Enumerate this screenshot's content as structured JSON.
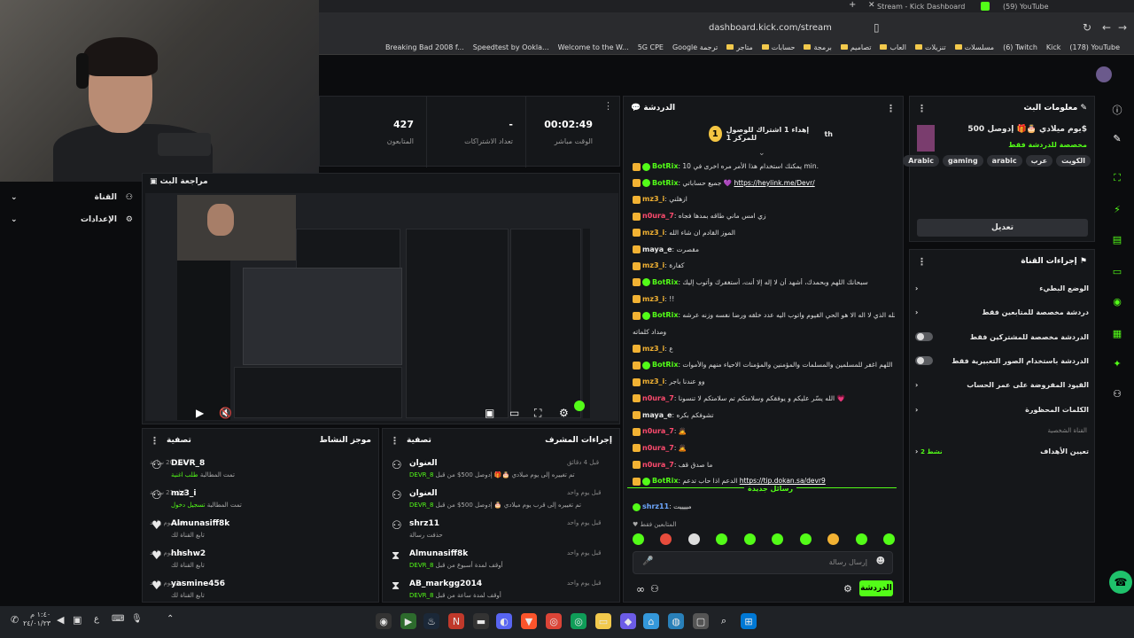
{
  "browser": {
    "tabs": [
      {
        "label": "Stream - Kick Dashboard"
      },
      {
        "label": "(59) YouTube"
      }
    ],
    "url": "dashboard.kick.com/stream",
    "bookmarks": [
      "(178) YouTube",
      "Kick",
      "(6) Twitch",
      "مسلسلات",
      "تنزيلات",
      "العاب",
      "تصاميم",
      "برمجة",
      "حسابات",
      "متاجر",
      "Google ترجمة",
      "5G CPE",
      "Welcome to the W...",
      "Speedtest by Ookla...",
      "Breaking Bad 2008 f..."
    ]
  },
  "sidebar": {
    "channel": "القناة",
    "settings": "الإعدادات"
  },
  "stats": {
    "live_time_value": "00:02:49",
    "live_time_label": "الوقت مباشر",
    "subs_value": "-",
    "subs_label": "تعداد الاشتراكات",
    "viewers_value": "427",
    "viewers_label": "المتابعون"
  },
  "preview": {
    "title": "مراجعة البث"
  },
  "activity": {
    "title": "موجز النشاط",
    "filter": "تصفية",
    "items": [
      {
        "name": "DEVR_8",
        "sub": "تمت المطالبة",
        "sub2": "طلب اغنية",
        "time": "قبل 20 ساعة"
      },
      {
        "name": "mz3_i",
        "sub": "تمت المطالبة",
        "sub2": "تسجيل دخول",
        "time": "قبل 21 ساعة"
      },
      {
        "name": "Almunasiff8k",
        "sub": "تابع القناة لك",
        "sub2": "",
        "time": "قبل يوم واحد"
      },
      {
        "name": "hhshw2",
        "sub": "تابع القناة لك",
        "sub2": "",
        "time": "قبل يوم واحد"
      },
      {
        "name": "yasmine456",
        "sub": "تابع القناة لك",
        "sub2": "",
        "time": "قبل يوم واحد"
      }
    ]
  },
  "modactions": {
    "title": "إجراءات المشرف",
    "filter": "تصفية",
    "items": [
      {
        "name": "العنوان",
        "sub": "تم تغييره إلى يوم ميلادي 🎂🎁 إدوصل 500$ من قبل",
        "by": "DEVR_8",
        "time": "قبل 4 دقائق"
      },
      {
        "name": "العنوان",
        "sub": "تم تغييره إلى قرب يوم ميلادي 🎂 إدوصل 500$ من قبل",
        "by": "DEVR_8",
        "time": "قبل يوم واحد"
      },
      {
        "name": "shrz11",
        "sub": "حذفت رسالة",
        "by": "",
        "time": "قبل يوم واحد"
      },
      {
        "name": "Almunasiff8k",
        "sub": "أوقف لمدة أسبوع من قبل",
        "by": "DEVR_8",
        "time": "قبل يوم واحد"
      },
      {
        "name": "AB_markgg2014",
        "sub": "أوقف لمدة ساعة من قبل",
        "by": "DEVR_8",
        "time": "قبل يوم واحد"
      }
    ]
  },
  "chat": {
    "title": "الدردشة",
    "pinned_count": "1",
    "pinned_text": "إهداء 1 اشتراك للوصول للمركز 1",
    "pinned_suffix": "th",
    "messages": [
      {
        "user": "BotRix",
        "cls": "cbrix",
        "text": "يمكنك استخدام هذا الأمر مره اخرى في 10 min.",
        "link": ""
      },
      {
        "user": "BotRix",
        "cls": "cbrix",
        "text": "جميع حساباتي 💜",
        "link": "https://heylink.me/Devr/"
      },
      {
        "user": "mz3_i",
        "cls": "cmz",
        "text": "ازهلني",
        "link": ""
      },
      {
        "user": "n0ura_7",
        "cls": "cnour",
        "text": "زي امس ماني طاقه بمدها فجاه",
        "link": ""
      },
      {
        "user": "mz3_i",
        "cls": "cmz",
        "text": "الموز القادم ان شاء الله",
        "link": ""
      },
      {
        "user": "maya_e",
        "cls": "cmaya",
        "text": "مقصرت",
        "link": ""
      },
      {
        "user": "mz3_i",
        "cls": "cmz",
        "text": "كفارة",
        "link": ""
      },
      {
        "user": "BotRix",
        "cls": "cbrix",
        "text": "سبحانك اللهم وبحمدك، أشهد أن لا إله إلا أنت، أستغفرك وأتوب إليك",
        "link": ""
      },
      {
        "user": "mz3_i",
        "cls": "cmz",
        "text": "!!",
        "link": ""
      },
      {
        "user": "BotRix",
        "cls": "cbrix",
        "text": "استغفر الله الذي لا اله الا هو الحي القيوم واتوب اليه عدد خلقه ورضا نفسه وزنه عرشه",
        "link": ""
      },
      {
        "user": "",
        "cls": "cbrix",
        "text": "ومداد كلماته",
        "link": ""
      },
      {
        "user": "mz3_i",
        "cls": "cmz",
        "text": "ع",
        "link": ""
      },
      {
        "user": "BotRix",
        "cls": "cbrix",
        "text": "اللهم اغفر للمسلمين والمسلمات والمؤمنين والمؤمنات الاحياء منهم والأموات",
        "link": ""
      },
      {
        "user": "mz3_i",
        "cls": "cmz",
        "text": "وو عندنا باجر",
        "link": ""
      },
      {
        "user": "n0ura_7",
        "cls": "cnour",
        "text": "الله يسّر عليكم و يوفقكم وسلامتكم تم سلامتكم لا تنسونا 💗",
        "link": ""
      },
      {
        "user": "maya_e",
        "cls": "cmaya",
        "text": "تشوفكم بكره",
        "link": ""
      },
      {
        "user": "n0ura_7",
        "cls": "cnour",
        "text": "🙇",
        "link": ""
      },
      {
        "user": "n0ura_7",
        "cls": "cnour",
        "text": "🙇",
        "link": ""
      },
      {
        "user": "n0ura_7",
        "cls": "cnour",
        "text": "ما صدق قف",
        "link": ""
      },
      {
        "user": "BotRix",
        "cls": "cbrix",
        "text": "الدعم اذا حاب تدعم",
        "link": "https://tip.dokan.sa/devr9"
      }
    ],
    "new_messages": "رسائل جديدة",
    "last_user": "shrz11",
    "last_text": "مييييت",
    "followers_only": "المتابعين فقط",
    "input_placeholder": "إرسال رسالة",
    "send": "الدردشة"
  },
  "streaminfo": {
    "title": "معلومات البث",
    "stream_title": "يوم ميلادي 🎂🎁 إدوصل 500$",
    "subtitle": "مخصصة للدردشة فقط",
    "tags": [
      "Arabic",
      "gaming",
      "arabic",
      "عرب",
      "الكويت"
    ],
    "edit": "تعديل"
  },
  "chatsettings": {
    "title": "إجراءات القناة",
    "rows": [
      {
        "label": "الوضع البطيء",
        "type": "arrow",
        "extra": ""
      },
      {
        "label": "دردشة مخصصة للمتابعين فقط",
        "type": "arrow",
        "extra": ""
      },
      {
        "label": "الدردشة مخصصة للمشتركين فقط",
        "type": "toggle",
        "extra": ""
      },
      {
        "label": "الدردشة باستخدام الصور التعبيرية فقط",
        "type": "toggle",
        "extra": ""
      },
      {
        "label": "القيود المفروضة على عمر الحساب",
        "type": "arrow",
        "extra": ""
      },
      {
        "label": "الكلمات المحظورة",
        "type": "arrow",
        "extra": ""
      }
    ],
    "channel_label": "القناة الشخصية",
    "goals": "تعيين الأهداف",
    "goals_extra": "2 نشط"
  },
  "taskbar": {
    "time": "١:٤٠ م",
    "date": "٢٤/٠١/٢٣"
  },
  "colors": {
    "accent": "#53fc18",
    "bg": "#0b0c0e",
    "panel": "#15171a"
  }
}
